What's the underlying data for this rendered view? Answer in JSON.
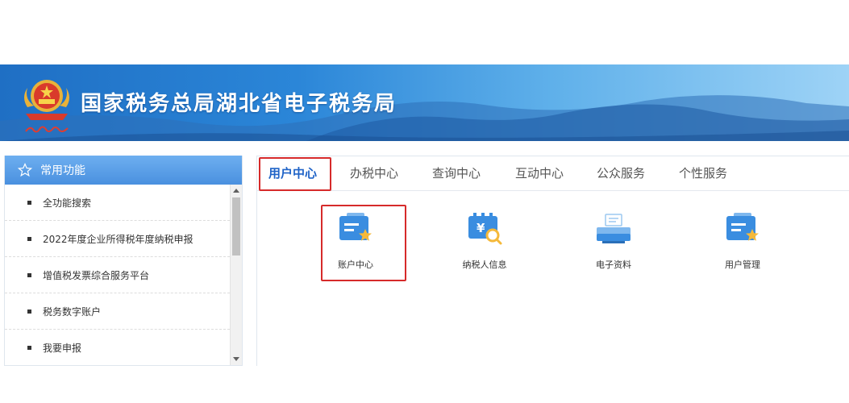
{
  "header": {
    "title": "国家税务总局湖北省电子税务局",
    "emblem_icon": "national-emblem-icon",
    "slogan_icon": "handwritten-slogan-icon"
  },
  "sidebar": {
    "header_label": "常用功能",
    "header_icon": "star-outline-icon",
    "items": [
      {
        "label": "全功能搜索"
      },
      {
        "label": "2022年度企业所得税年度纳税申报"
      },
      {
        "label": "增值税发票综合服务平台"
      },
      {
        "label": "税务数字账户"
      },
      {
        "label": "我要申报"
      }
    ]
  },
  "tabs": [
    {
      "label": "用户中心",
      "active": true
    },
    {
      "label": "办税中心",
      "active": false
    },
    {
      "label": "查询中心",
      "active": false
    },
    {
      "label": "互动中心",
      "active": false
    },
    {
      "label": "公众服务",
      "active": false
    },
    {
      "label": "个性服务",
      "active": false
    }
  ],
  "functions": [
    {
      "label": "账户中心",
      "icon": "account-card-star-icon"
    },
    {
      "label": "纳税人信息",
      "icon": "taxpayer-yuan-search-icon"
    },
    {
      "label": "电子资料",
      "icon": "electronic-documents-icon"
    },
    {
      "label": "用户管理",
      "icon": "user-management-card-star-icon"
    }
  ],
  "colors": {
    "accent": "#1f63c7",
    "highlight": "#d62a2a",
    "sidebar_header": "#5a9ee6",
    "icon_blue": "#3a8de0",
    "icon_star": "#f5b93a"
  }
}
